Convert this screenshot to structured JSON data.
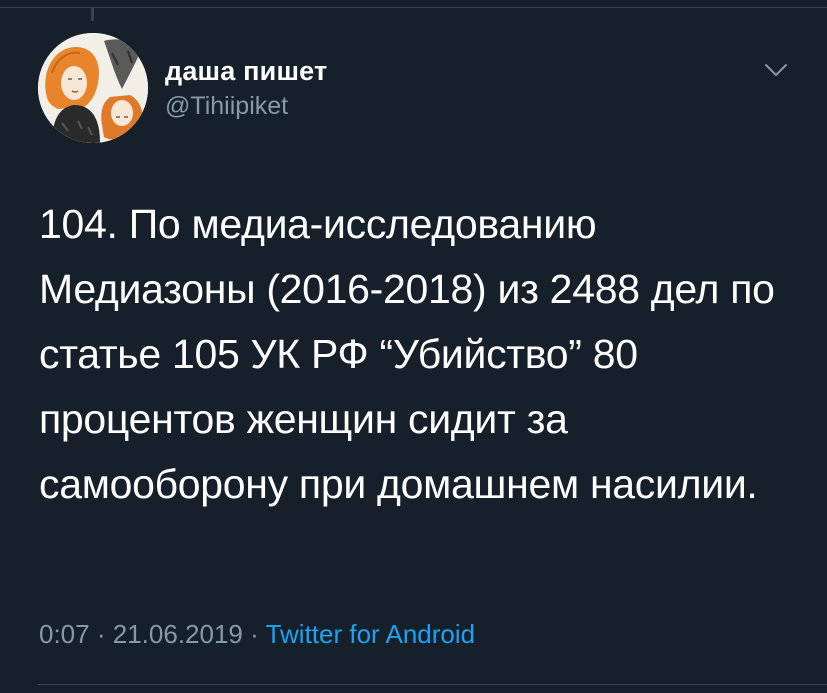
{
  "tweet": {
    "author": {
      "display_name": "даша пишет",
      "handle": "@Tihiipiket"
    },
    "text": "104. По медиа-исследованию Медиазоны (2016-2018) из 2488 дел по статье 105 УК РФ “Убийство” 80 процентов женщин сидит за самооборону при домашнем насилии.",
    "time": "0:07",
    "separator": "·",
    "date": "21.06.2019",
    "source": "Twitter for Android"
  },
  "icons": {
    "menu": "chevron-down-icon",
    "avatar": "avatar-drawing"
  },
  "colors": {
    "background": "#15202b",
    "text": "#ffffff",
    "secondary_text": "#8899a6",
    "link": "#1da1f2",
    "divider": "#38444d"
  }
}
